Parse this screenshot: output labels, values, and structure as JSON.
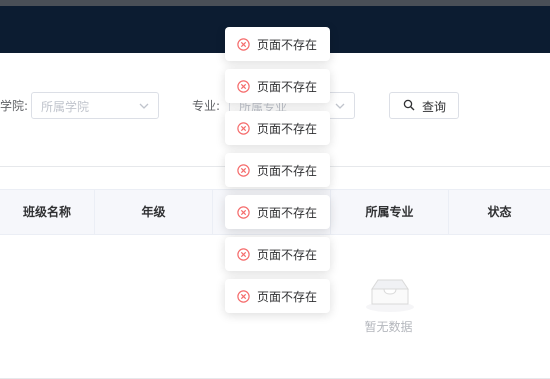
{
  "filters": {
    "college_label": "学院:",
    "college_placeholder": "所属学院",
    "major_label": "专业:",
    "major_placeholder": "所属专业",
    "query_label": "查询"
  },
  "table": {
    "columns": [
      "班级名称",
      "年级",
      "",
      "所属专业",
      "状态"
    ],
    "empty_text": "暂无数据"
  },
  "toasts": [
    "页面不存在",
    "页面不存在",
    "页面不存在",
    "页面不存在",
    "页面不存在",
    "页面不存在",
    "页面不存在"
  ],
  "colors": {
    "topbar": "#0c1c31",
    "error": "#f56c6c"
  },
  "icons": {
    "toast": "circle-x-icon",
    "select": "chevron-down-icon",
    "query": "search-icon",
    "empty": "empty-inbox-icon"
  }
}
